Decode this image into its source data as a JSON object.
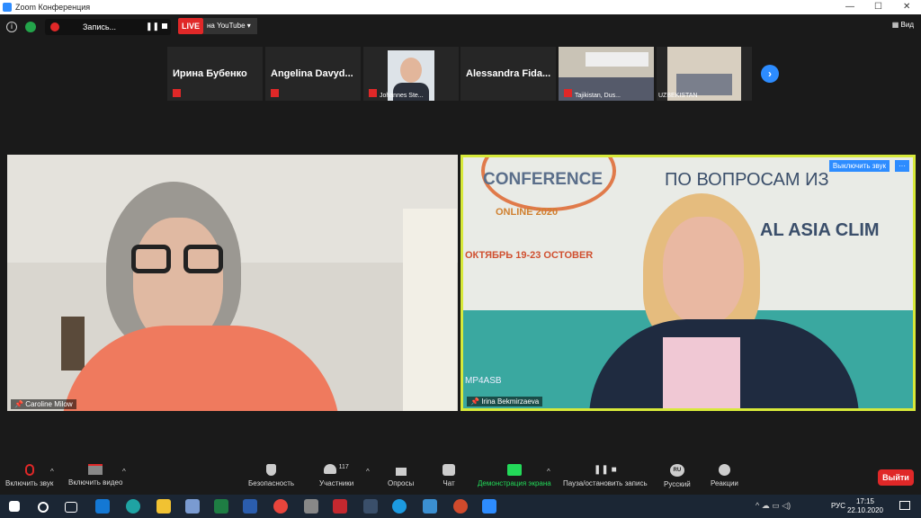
{
  "window": {
    "title": "Zoom Конференция"
  },
  "topbar": {
    "recording_label": "Запись...",
    "live_label": "LIVE",
    "youtube_label": "на YouTube ▾",
    "view_label": "Вид"
  },
  "strip": [
    {
      "name": "Ирина Бубенко"
    },
    {
      "name": "Angelina Davyd..."
    },
    {
      "caption": "Johannes Ste..."
    },
    {
      "name": "Alessandra Fida..."
    },
    {
      "caption": "Tajikistan, Dus..."
    },
    {
      "caption": "UZBEKISTAN"
    }
  ],
  "videos": {
    "left": {
      "label": "Caroline Milow"
    },
    "right": {
      "label": "Irina Bekmirzaeva",
      "unmute_label": "Выключить звук",
      "more_label": "···",
      "sign_lines": [
        "CONFERENCE",
        "ONLINE 2020",
        "ОКТЯБРЬ 19-23 OCTOBER",
        "ПО ВОПРОСАМ ИЗ",
        "AL ASIA CLIM",
        "MP4ASB"
      ]
    }
  },
  "toolbar": {
    "unmute": "Включить звук",
    "start_video": "Включить видео",
    "security": "Безопасность",
    "participants": "Участники",
    "participants_count": "117",
    "polls": "Опросы",
    "chat": "Чат",
    "share": "Демонстрация экрана",
    "pause_rec": "Пауза/остановить запись",
    "language": "Русский",
    "language_badge": "RU",
    "reactions": "Реакции",
    "leave": "Выйти"
  },
  "taskbar": {
    "lang": "РУС",
    "time": "17:15",
    "date": "22.10.2020"
  },
  "colors": {
    "accent": "#2D8CFF",
    "live": "#E02828",
    "active_speaker": "#D7E93A",
    "share_green": "#23D959"
  }
}
